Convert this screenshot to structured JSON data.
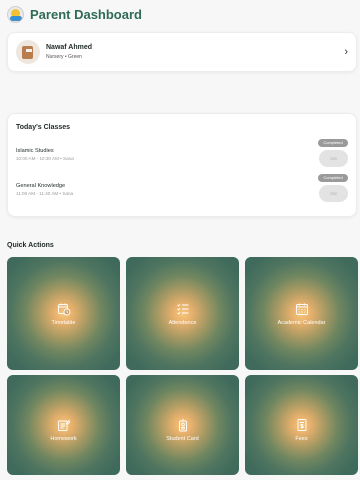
{
  "header": {
    "title": "Parent Dashboard",
    "logo_icon": "school-logo-icon"
  },
  "student": {
    "name": "Nawaf Ahmed",
    "meta": "Nursery • Green",
    "chevron_icon": "chevron-right-icon"
  },
  "todays_classes": {
    "title": "Today's Classes",
    "classes": [
      {
        "name": "Islamic Studies",
        "time": "10:00 AM - 10:30 AM • Sana",
        "status": "Completed",
        "action": "Join"
      },
      {
        "name": "General Knowledge",
        "time": "11:00 AM - 11:40 AM • Sana",
        "status": "Completed",
        "action": "Join"
      }
    ]
  },
  "quick_actions": {
    "title": "Quick Actions",
    "items": [
      {
        "label": "Timetable",
        "icon": "calendar-clock-icon"
      },
      {
        "label": "Attendence",
        "icon": "checklist-icon"
      },
      {
        "label": "Academic Calendar",
        "icon": "calendar-grid-icon"
      },
      {
        "label": "Homework",
        "icon": "homework-icon"
      },
      {
        "label": "Student Card",
        "icon": "id-badge-icon"
      },
      {
        "label": "Fees",
        "icon": "receipt-icon"
      }
    ]
  },
  "colors": {
    "brand": "#2f6a57",
    "tile_edge": "#3d695b",
    "tile_glow": "#f7c77c",
    "badge": "#9a9a9a"
  }
}
